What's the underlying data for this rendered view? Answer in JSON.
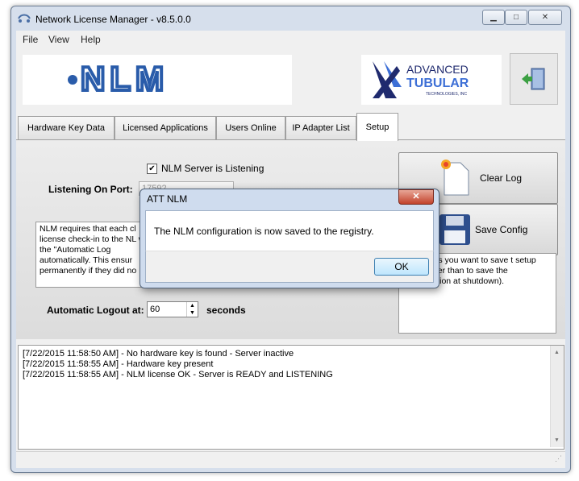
{
  "window": {
    "title": "Network License Manager - v8.5.0.0"
  },
  "menu": [
    "File",
    "View",
    "Help"
  ],
  "logo": {
    "text": "NLM"
  },
  "att_logo": {
    "line1": "ADVANCED",
    "line2": "TUBULAR",
    "line3": "TECHNOLOGIES, INC"
  },
  "tabs": [
    "Hardware Key Data",
    "Licensed Applications",
    "Users Online",
    "IP Adapter List",
    "Setup"
  ],
  "setup": {
    "listening_checkbox_label": "NLM Server is Listening",
    "listening_checked": true,
    "port_label": "Listening On Port:",
    "port_value": "17592",
    "info_text": "NLM requires that each cl license check-in to the NL within the \"Automatic Log automatically.  This ensur permanently if they did no",
    "logout_label": "Automatic Logout at:",
    "logout_value": "60",
    "logout_unit": "seconds"
  },
  "buttons": {
    "clear_log": "Clear Log",
    "save_config": "Save Config"
  },
  "side_note": "e Config is you want to save t setup now (rather than to save the configuration at shutdown).",
  "log_lines": [
    "[7/22/2015 11:58:50 AM] - No hardware key is found - Server inactive",
    "[7/22/2015 11:58:55 AM] - Hardware key present",
    "[7/22/2015 11:58:55 AM] - NLM license OK - Server is READY and LISTENING"
  ],
  "dialog": {
    "title": "ATT NLM",
    "message": "The NLM configuration is now saved to the registry.",
    "ok": "OK",
    "close": "✕"
  },
  "colors": {
    "nlm_blue": "#2a5caa",
    "att_navy": "#1f2a6e",
    "att_blue": "#3d6fd6"
  }
}
